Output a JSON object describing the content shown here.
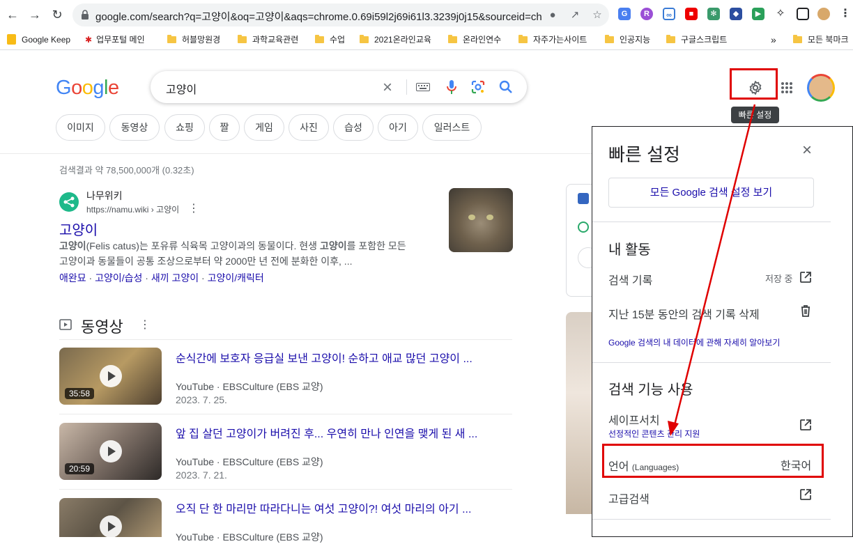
{
  "browser": {
    "url": "google.com/search?q=고양이&oq=고양이&aqs=chrome.0.69i59l2j69i61l3.3239j0j15&sourceid=chr...",
    "bookmarks": [
      {
        "label": "Google Keep",
        "icon": "keep-icon"
      },
      {
        "label": "업무포털 메인",
        "icon": "portal-icon"
      },
      {
        "label": "허블망원경",
        "icon": "folder-icon"
      },
      {
        "label": "과학교육관련",
        "icon": "folder-icon"
      },
      {
        "label": "수업",
        "icon": "folder-icon"
      },
      {
        "label": "2021온라인교육",
        "icon": "folder-icon"
      },
      {
        "label": "온라인연수",
        "icon": "folder-icon"
      },
      {
        "label": "자주가는사이트",
        "icon": "folder-icon"
      },
      {
        "label": "인공지능",
        "icon": "folder-icon"
      },
      {
        "label": "구글스크립트",
        "icon": "folder-icon"
      }
    ],
    "bookmarks_overflow": "»",
    "all_bookmarks": "모든 북마크"
  },
  "google": {
    "logo": "Google",
    "query": "고양이",
    "chips": [
      "이미지",
      "동영상",
      "쇼핑",
      "짤",
      "게임",
      "사진",
      "습성",
      "아기",
      "일러스트"
    ],
    "stats": "검색결과 약 78,500,000개 (0.32초)",
    "settings_tooltip": "빠른 설정"
  },
  "result1": {
    "site": "나무위키",
    "cite": "https://namu.wiki › 고양이",
    "title": "고양이",
    "snippet1_bold": "고양이",
    "snippet1_rest": "(Felis catus)는 포유류 식육목 고양이과의 동물이다. 현생 ",
    "snippet1_bold2": "고양이",
    "snippet1_end": "를 포함한 모든",
    "snippet2": "고양이과 동물들이 공통 조상으로부터 약 2000만 년 전에 분화한 이후, ...",
    "sitelinks": [
      "애완묘",
      "고양이/습성",
      "새끼 고양이",
      "고양이/캐릭터"
    ]
  },
  "videos": {
    "header": "동영상",
    "items": [
      {
        "title": "순식간에 보호자 응급실 보낸 고양이! 순하고 애교 많던 고양이 ...",
        "source": "YouTube · EBSCulture (EBS 교양)",
        "date": "2023. 7. 25.",
        "duration": "35:58"
      },
      {
        "title": "앞 집 살던 고양이가 버려진 후... 우연히 만나 인연을 맺게 된 새 ...",
        "source": "YouTube · EBSCulture (EBS 교양)",
        "date": "2023. 7. 21.",
        "duration": "20:59"
      },
      {
        "title": "오직 단 한 마리만 따라다니는 여섯 고양이?! 여섯 마리의 아기 ...",
        "source": "YouTube · EBSCulture (EBS 교양)",
        "date": "",
        "duration": ""
      }
    ]
  },
  "quick_settings": {
    "title": "빠른 설정",
    "all_settings": "모든 Google 검색 설정 보기",
    "activity_header": "내 활동",
    "search_history": "검색 기록",
    "saving": "저장 중",
    "delete_15": "지난 15분 동안의 검색 기록 삭제",
    "data_link": "Google 검색의 내 데이터에 관해 자세히 알아보기",
    "features_header": "검색 기능 사용",
    "safesearch": "세이프서치",
    "safesearch_sub": "선정적인 콘텐츠 관리 지원",
    "language": "언어",
    "language_en": "(Languages)",
    "language_value": "한국어",
    "advanced": "고급검색"
  }
}
